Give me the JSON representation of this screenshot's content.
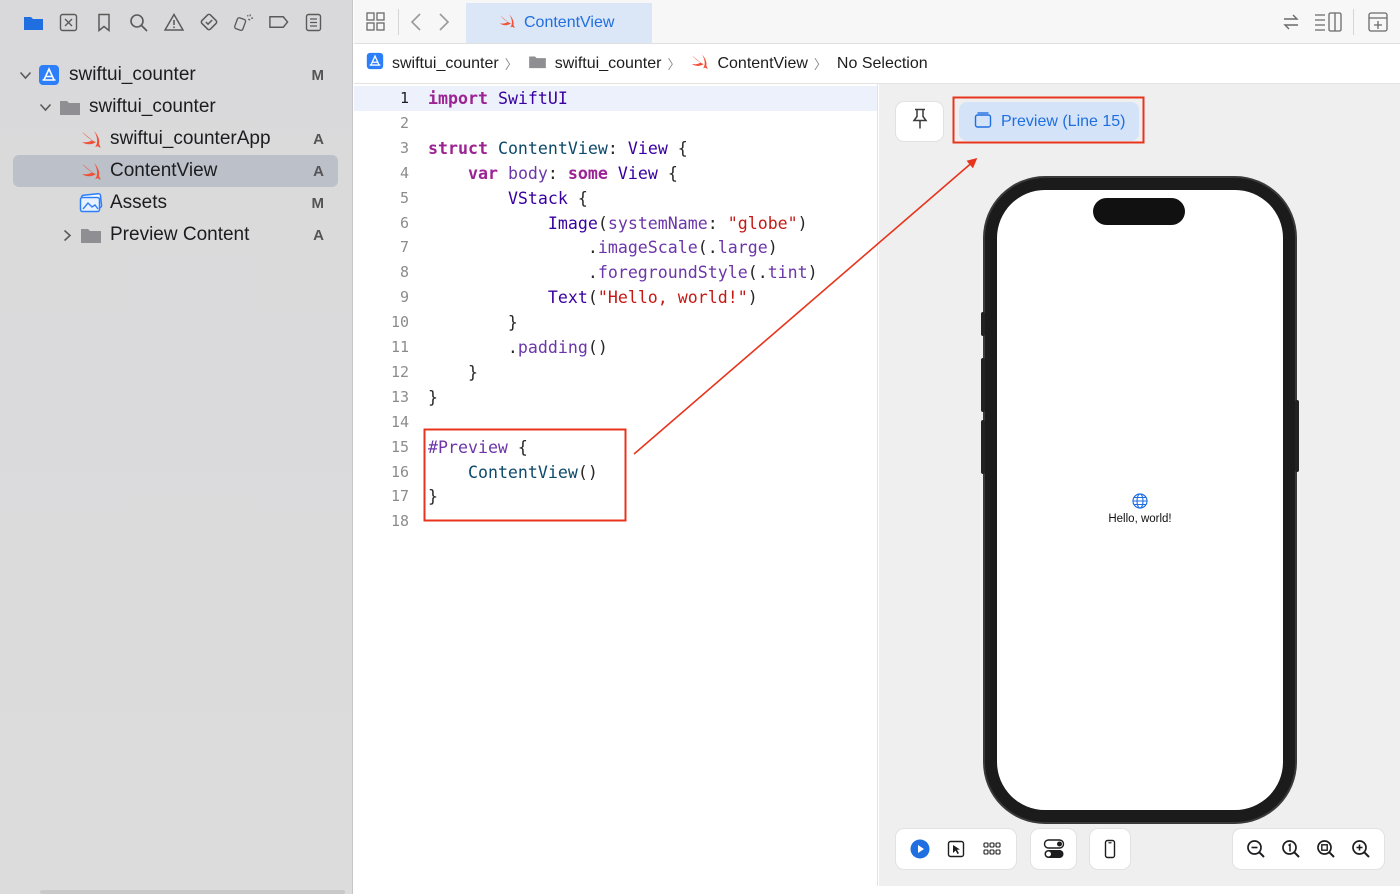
{
  "sidebar": {
    "toolbar_icons": [
      "folder-icon",
      "source-control-icon",
      "bookmark-icon",
      "find-icon",
      "warning-icon",
      "test-icon",
      "debug-icon",
      "breakpoint-icon",
      "report-icon"
    ],
    "tree": [
      {
        "label": "swiftui_counter",
        "badge": "M",
        "icon": "app-project-icon",
        "expanded": true
      },
      {
        "label": "swiftui_counter",
        "badge": "",
        "icon": "folder-icon",
        "expanded": true
      },
      {
        "label": "swiftui_counterApp",
        "badge": "A",
        "icon": "swift-file-icon"
      },
      {
        "label": "ContentView",
        "badge": "A",
        "icon": "swift-file-icon",
        "selected": true
      },
      {
        "label": "Assets",
        "badge": "M",
        "icon": "assets-icon"
      },
      {
        "label": "Preview Content",
        "badge": "A",
        "icon": "folder-icon",
        "expanded": false
      }
    ]
  },
  "tabs": {
    "active": "ContentView"
  },
  "breadcrumb": {
    "items": [
      "swiftui_counter",
      "swiftui_counter",
      "ContentView",
      "No Selection"
    ]
  },
  "code": {
    "lines": [
      "import SwiftUI",
      "",
      "struct ContentView: View {",
      "    var body: some View {",
      "        VStack {",
      "            Image(systemName: \"globe\")",
      "                .imageScale(.large)",
      "                .foregroundStyle(.tint)",
      "            Text(\"Hello, world!\")",
      "        }",
      "        .padding()",
      "    }",
      "}",
      "",
      "#Preview {",
      "    ContentView()",
      "}",
      ""
    ],
    "line_numbers": [
      "1",
      "2",
      "3",
      "4",
      "5",
      "6",
      "7",
      "8",
      "9",
      "10",
      "11",
      "12",
      "13",
      "14",
      "15",
      "16",
      "17",
      "18"
    ],
    "active_line": 1
  },
  "preview": {
    "pin_icon": "pin-icon",
    "button_label": "Preview (Line 15)",
    "device_text": "Hello, world!"
  },
  "colors": {
    "accent": "#1f6fe0",
    "annotation": "#e8341c",
    "keyword": "#9b2393",
    "string": "#c41a16"
  }
}
